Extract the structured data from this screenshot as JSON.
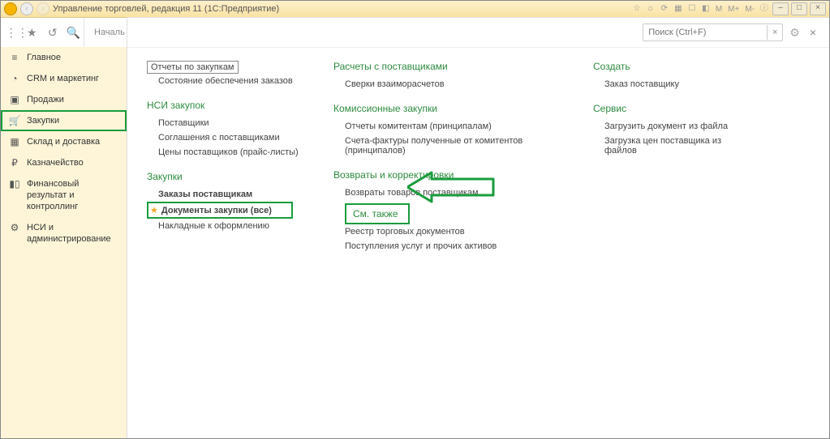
{
  "titlebar": {
    "title": "Управление торговлей, редакция 11  (1С:Предприятие)",
    "right_labels": [
      "M",
      "M+",
      "M-"
    ]
  },
  "toolbar": {
    "start_label": "Началь"
  },
  "search": {
    "placeholder": "Поиск (Ctrl+F)"
  },
  "sidebar": {
    "items": [
      {
        "icon": "menu-icon",
        "label": "Главное"
      },
      {
        "icon": "pie-icon",
        "label": "CRM и маркетинг"
      },
      {
        "icon": "bag-icon",
        "label": "Продажи"
      },
      {
        "icon": "cart-icon",
        "label": "Закупки",
        "active": true
      },
      {
        "icon": "box-icon",
        "label": "Склад и доставка"
      },
      {
        "icon": "ruble-icon",
        "label": "Казначейство"
      },
      {
        "icon": "chart-icon",
        "label": "Финансовый результат и контроллинг"
      },
      {
        "icon": "gear-icon",
        "label": "НСИ и администрирование"
      }
    ]
  },
  "col1": {
    "g0_link": "Отчеты по закупкам",
    "g0_l1": "Состояние обеспечения заказов",
    "g1_title": "НСИ закупок",
    "g1_l1": "Поставщики",
    "g1_l2": "Соглашения с поставщиками",
    "g1_l3": "Цены поставщиков (прайс-листы)",
    "g2_title": "Закупки",
    "g2_l1": "Заказы поставщикам",
    "g2_l2": "Документы закупки (все)",
    "g2_l3": "Накладные к оформлению"
  },
  "col2": {
    "g1_title": "Расчеты с поставщиками",
    "g1_l1": "Сверки взаиморасчетов",
    "g2_title": "Комиссионные закупки",
    "g2_l1": "Отчеты комитентам (принципалам)",
    "g2_l2": "Счета-фактуры полученные от комитентов (принципалов)",
    "g3_title": "Возвраты и корректировки",
    "g3_l1": "Возвраты товаров поставщикам",
    "g4_title": "См. также",
    "g4_l1": "Реестр торговых документов",
    "g4_l2": "Поступления услуг и прочих активов"
  },
  "col3": {
    "g1_title": "Создать",
    "g1_l1": "Заказ поставщику",
    "g2_title": "Сервис",
    "g2_l1": "Загрузить документ из файла",
    "g2_l2": "Загрузка цен поставщика из файлов"
  }
}
